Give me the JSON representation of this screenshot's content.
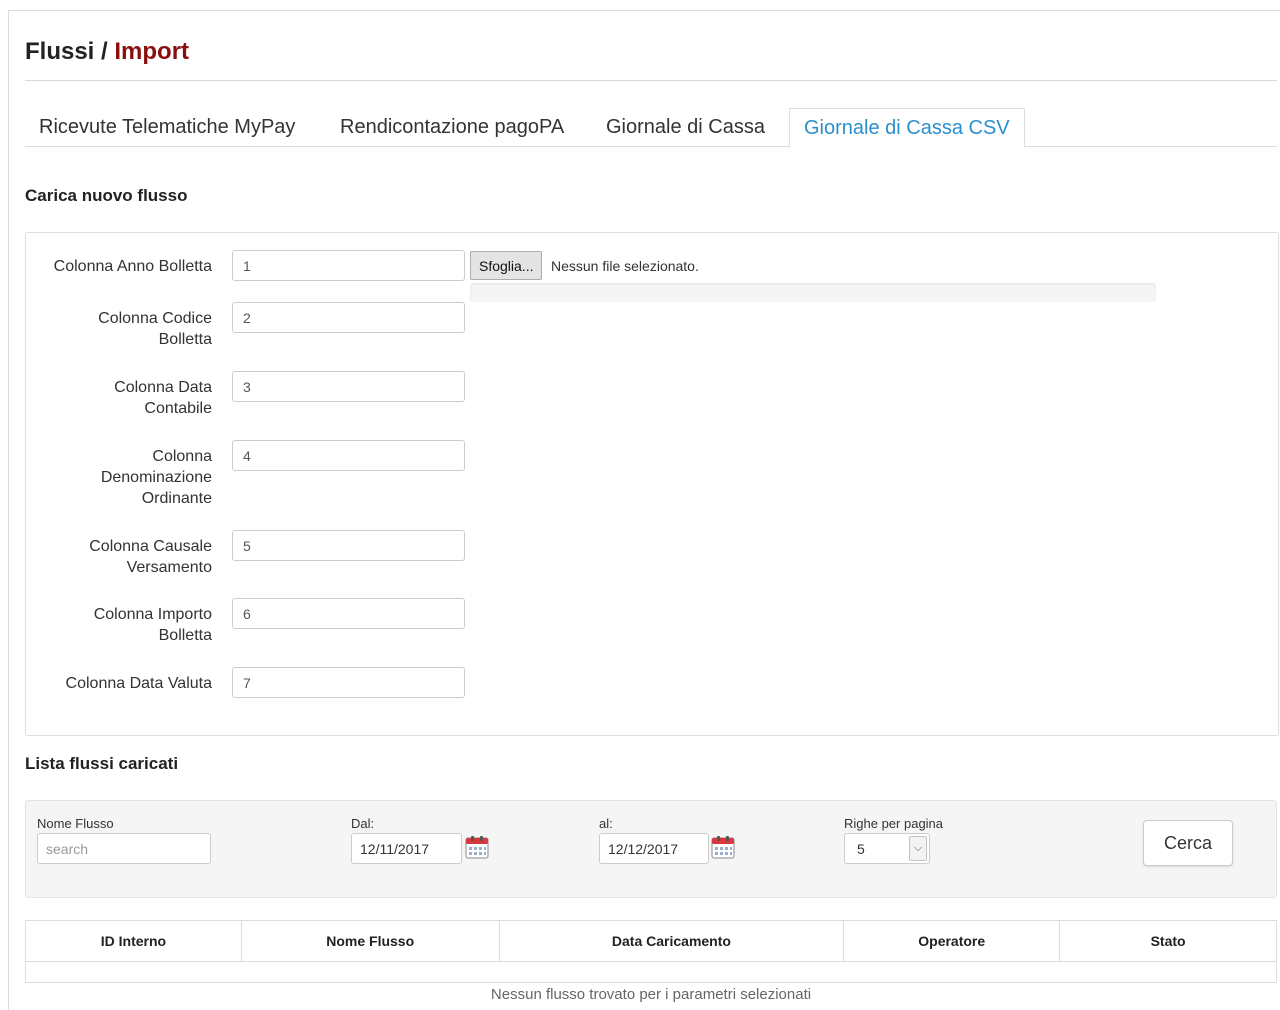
{
  "breadcrumb": {
    "parent": "Flussi",
    "separator": "/",
    "current": "Import"
  },
  "tabs": [
    {
      "label": "Ricevute Telematiche MyPay",
      "active": false
    },
    {
      "label": "Rendicontazione pagoPA",
      "active": false
    },
    {
      "label": "Giornale di Cassa",
      "active": false
    },
    {
      "label": "Giornale di Cassa CSV",
      "active": true
    }
  ],
  "upload": {
    "title": "Carica nuovo flusso",
    "browse_label": "Sfoglia...",
    "file_status": "Nessun file selezionato.",
    "progress": 0,
    "fields": [
      {
        "label_lines": [
          "Colonna Anno Bolletta"
        ],
        "value": "1"
      },
      {
        "label_lines": [
          "Colonna Codice",
          "Bolletta"
        ],
        "value": "2"
      },
      {
        "label_lines": [
          "Colonna Data",
          "Contabile"
        ],
        "value": "3"
      },
      {
        "label_lines": [
          "Colonna",
          "Denominazione",
          "Ordinante"
        ],
        "value": "4"
      },
      {
        "label_lines": [
          "Colonna Causale",
          "Versamento"
        ],
        "value": "5"
      },
      {
        "label_lines": [
          "Colonna Importo",
          "Bolletta"
        ],
        "value": "6"
      },
      {
        "label_lines": [
          "Colonna Data Valuta"
        ],
        "value": "7"
      }
    ]
  },
  "list": {
    "title": "Lista flussi caricati",
    "filters": {
      "name_label": "Nome Flusso",
      "name_placeholder": "search",
      "from_label": "Dal:",
      "from_value": "12/11/2017",
      "to_label": "al:",
      "to_value": "12/12/2017",
      "rows_label": "Righe per pagina",
      "rows_value": "5",
      "search_button": "Cerca"
    },
    "columns": [
      "ID Interno",
      "Nome Flusso",
      "Data Caricamento",
      "Operatore",
      "Stato"
    ],
    "empty_message": "Nessun flusso trovato per i parametri selezionati"
  },
  "colors": {
    "accent": "#2a8fcc",
    "breadcrumb_current": "#8b0e0e"
  },
  "icons": {
    "date_picker": "calendar-icon",
    "select_arrow": "chevron-down-icon"
  }
}
